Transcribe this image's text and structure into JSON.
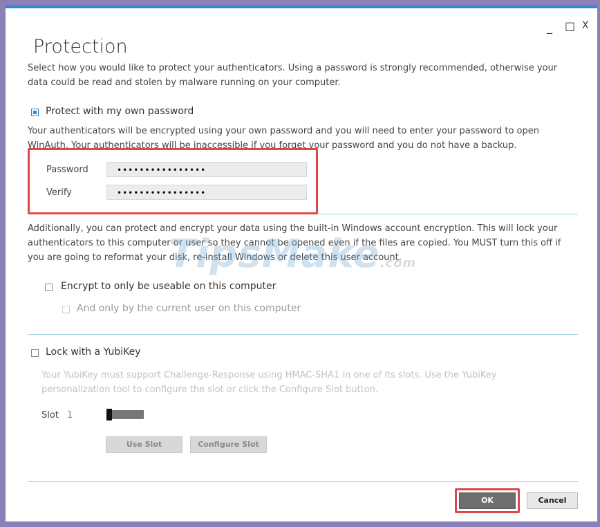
{
  "window": {
    "title": "Protection",
    "controls": {
      "minimize": "_",
      "maximize": "□",
      "close": "X"
    }
  },
  "intro_text": "Select how you would like to protect your authenticators. Using a password is strongly recommended, otherwise your data could be read and stolen by malware running on your computer.",
  "password_section": {
    "checkbox_label": "Protect with my own password",
    "checked": true,
    "description": "Your authenticators will be encrypted using your own password and you will need to enter your password to open WinAuth. Your authenticators will be inaccessible if you forget your password and you do not have a backup.",
    "password_label": "Password",
    "password_value": "••••••••••••••••",
    "verify_label": "Verify",
    "verify_value": "••••••••••••••••",
    "highlight_color": "#e04646"
  },
  "windows_section": {
    "description": "Additionally, you can protect and encrypt your data using the built-in Windows account encryption. This will lock your authenticators to this computer or user so they cannot be opened even if the files are copied. You MUST turn this off if you are going to reformat your disk, re-install Windows or delete this user account.",
    "computer_label": "Encrypt to only be useable on this computer",
    "computer_checked": false,
    "user_label": "And only by the current user on this computer",
    "user_checked": false
  },
  "yubikey_section": {
    "checkbox_label": "Lock with a YubiKey",
    "checked": false,
    "description": "Your YubiKey must support Challenge-Response using HMAC-SHA1 in one of its slots. Use the YubiKey personalization tool to configure the slot or click the Configure Slot button.",
    "slot_label": "Slot",
    "slot_value": "1",
    "use_slot_label": "Use Slot",
    "configure_slot_label": "Configure Slot"
  },
  "footer": {
    "ok_label": "OK",
    "cancel_label": "Cancel"
  },
  "watermark": {
    "main": "TipsMake",
    "suffix": ".com"
  },
  "colors": {
    "accent": "#2c89d9",
    "separator": "#9fd3e6",
    "highlight": "#e04646",
    "frame": "#8b7fb8"
  }
}
